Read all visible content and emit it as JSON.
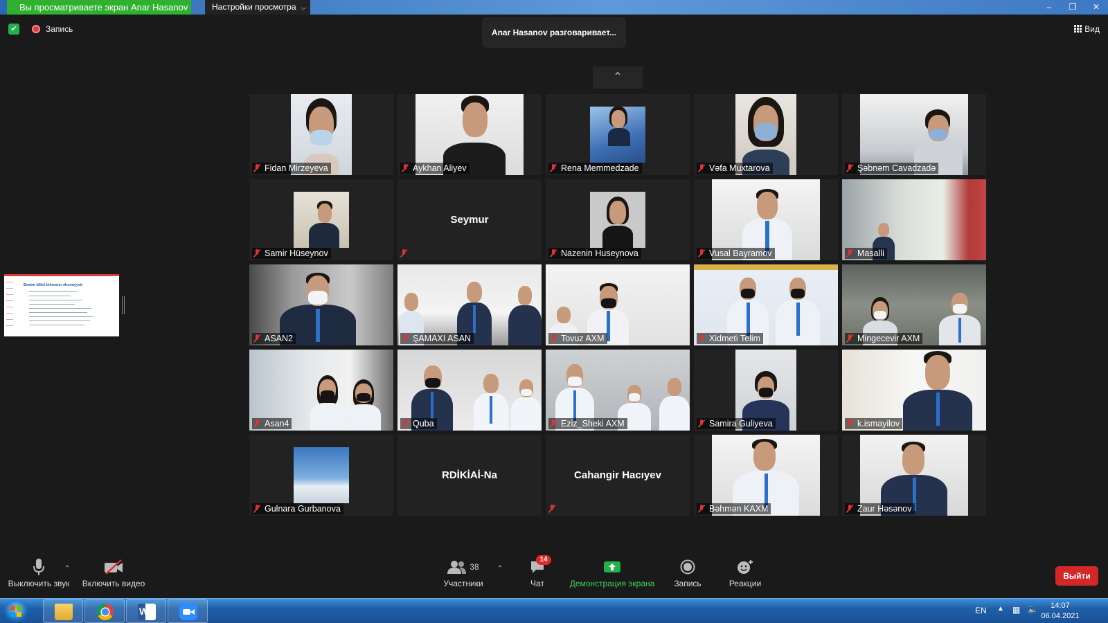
{
  "titlebar": {
    "share_tag": "Вы просматриваете экран Anar Hasanov",
    "view_options": "Настройки просмотра",
    "window_buttons": [
      "–",
      "❐",
      "✕"
    ]
  },
  "topbar": {
    "recording_label": "Запись",
    "speaker_text": "Anar Hasanov разговаривает...",
    "view_label": "Вид"
  },
  "shared_screen": {
    "title": "Bədən dilini bilmənin əhəmiyyəti"
  },
  "participants": [
    {
      "name": "Fidan Mirzeyeva",
      "muted": true
    },
    {
      "name": "Aykhan Aliyev",
      "muted": true
    },
    {
      "name": "Rena Memmedzade",
      "muted": true
    },
    {
      "name": "Vəfa Muxtarova",
      "muted": true
    },
    {
      "name": "Şəbnəm Cavadzadə",
      "muted": true
    },
    {
      "name": "Samir Hüseynov",
      "muted": true
    },
    {
      "name": "Seymur",
      "muted": true,
      "display_name": "Seymur"
    },
    {
      "name": "Nazenin Huseynova",
      "muted": true
    },
    {
      "name": "Vusal Bayramov",
      "muted": true
    },
    {
      "name": "Masalli",
      "muted": true
    },
    {
      "name": "ASAN2",
      "muted": true
    },
    {
      "name": "ŞAMAXI ASAN",
      "muted": true
    },
    {
      "name": "Tovuz AXM",
      "muted": true
    },
    {
      "name": "Xidmeti Telim",
      "muted": true
    },
    {
      "name": "Mingecevir AXM",
      "muted": true
    },
    {
      "name": "Asan4",
      "muted": true
    },
    {
      "name": "Quba",
      "muted": true
    },
    {
      "name": "Eziz_Sheki AXM",
      "muted": true
    },
    {
      "name": "Samira Guliyeva",
      "muted": true
    },
    {
      "name": "k.ismayilov",
      "muted": true
    },
    {
      "name": "Gulnara Gurbanova",
      "muted": true
    },
    {
      "name": "RDİKİAİ-Na",
      "muted": false,
      "display_name": "RDİKİAİ-Na"
    },
    {
      "name": "Cahangir Hacıyev",
      "muted": true,
      "display_name": "Cahangir Hacıyev"
    },
    {
      "name": "Bəhmən KAXM",
      "muted": true
    },
    {
      "name": "Zaur Həsənov",
      "muted": true
    }
  ],
  "toolbar": {
    "mute_label": "Выключить звук",
    "video_label": "Включить видео",
    "participants_label": "Участники",
    "participants_count": "38",
    "chat_label": "Чат",
    "chat_badge": "14",
    "share_label": "Демонстрация экрана",
    "record_label": "Запись",
    "reactions_label": "Реакции",
    "exit_label": "Выйти"
  },
  "taskbar": {
    "language": "EN",
    "time": "14:07",
    "date": "06.04.2021",
    "apps": [
      "explorer-icon",
      "chrome-icon",
      "word-icon",
      "zoom-icon"
    ]
  },
  "colors": {
    "share_green": "#2fb12f",
    "exit_red": "#d32828",
    "muted_red": "#dd3333",
    "share_screen_green": "#22b14c"
  }
}
